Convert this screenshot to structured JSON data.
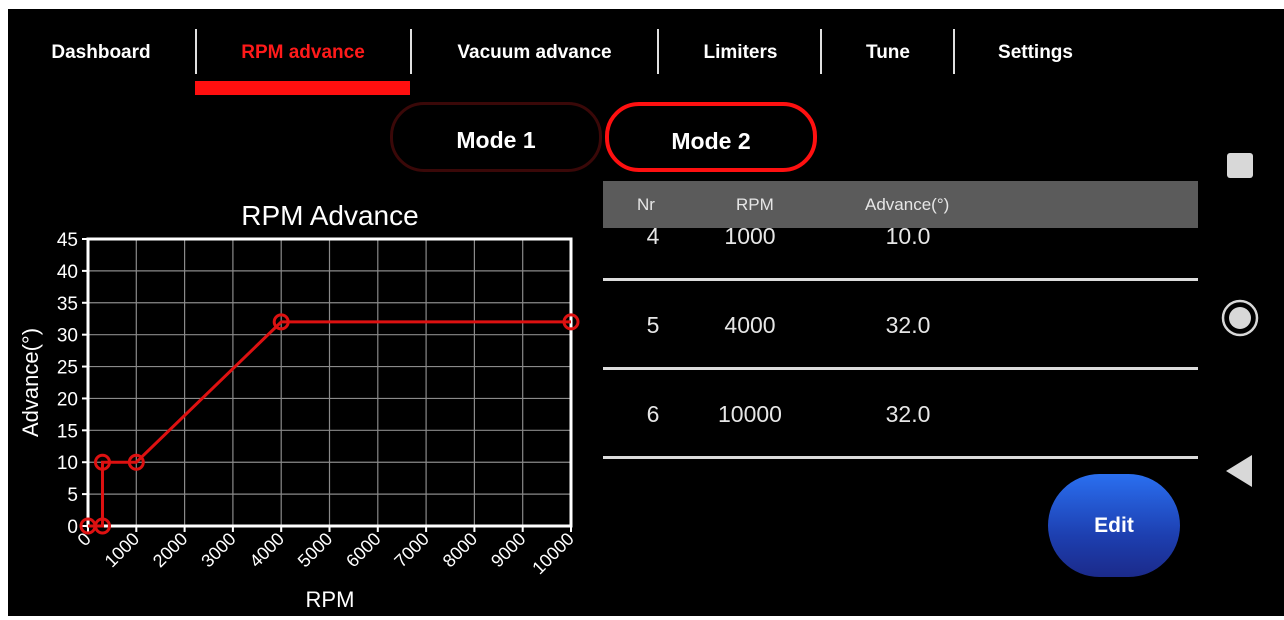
{
  "tabs": [
    {
      "label": "Dashboard",
      "active": false
    },
    {
      "label": "RPM advance",
      "active": true
    },
    {
      "label": "Vacuum advance",
      "active": false
    },
    {
      "label": "Limiters",
      "active": false
    },
    {
      "label": "Tune",
      "active": false
    },
    {
      "label": "Settings",
      "active": false
    }
  ],
  "modes": {
    "mode1": "Mode 1",
    "mode2": "Mode 2",
    "selected": "Mode 2"
  },
  "table": {
    "headers": {
      "nr": "Nr",
      "rpm": "RPM",
      "advance": "Advance(°)"
    },
    "rows": [
      {
        "nr": "4",
        "rpm": "1000",
        "advance": "10.0"
      },
      {
        "nr": "5",
        "rpm": "4000",
        "advance": "32.0"
      },
      {
        "nr": "6",
        "rpm": "10000",
        "advance": "32.0"
      }
    ]
  },
  "edit_label": "Edit",
  "colors": {
    "accent": "#ff1010",
    "background": "#000000",
    "edit_button": "#2a5ad0"
  },
  "nav_icons": [
    "square-icon",
    "home-circle-icon",
    "back-triangle-icon"
  ],
  "chart_data": {
    "type": "line",
    "title": "RPM Advance",
    "xlabel": "RPM",
    "ylabel": "Advance(°)",
    "xlim": [
      0,
      10000
    ],
    "ylim": [
      0,
      45
    ],
    "xticks": [
      "0",
      "1000",
      "2000",
      "3000",
      "4000",
      "5000",
      "6000",
      "7000",
      "8000",
      "9000",
      "10000"
    ],
    "yticks": [
      "0",
      "5",
      "10",
      "15",
      "20",
      "25",
      "30",
      "35",
      "40",
      "45"
    ],
    "grid": true,
    "series": [
      {
        "color": "#dd1111",
        "x": [
          0,
          300,
          300,
          1000,
          4000,
          10000
        ],
        "y": [
          0,
          0,
          10,
          10,
          32,
          32
        ]
      }
    ]
  }
}
